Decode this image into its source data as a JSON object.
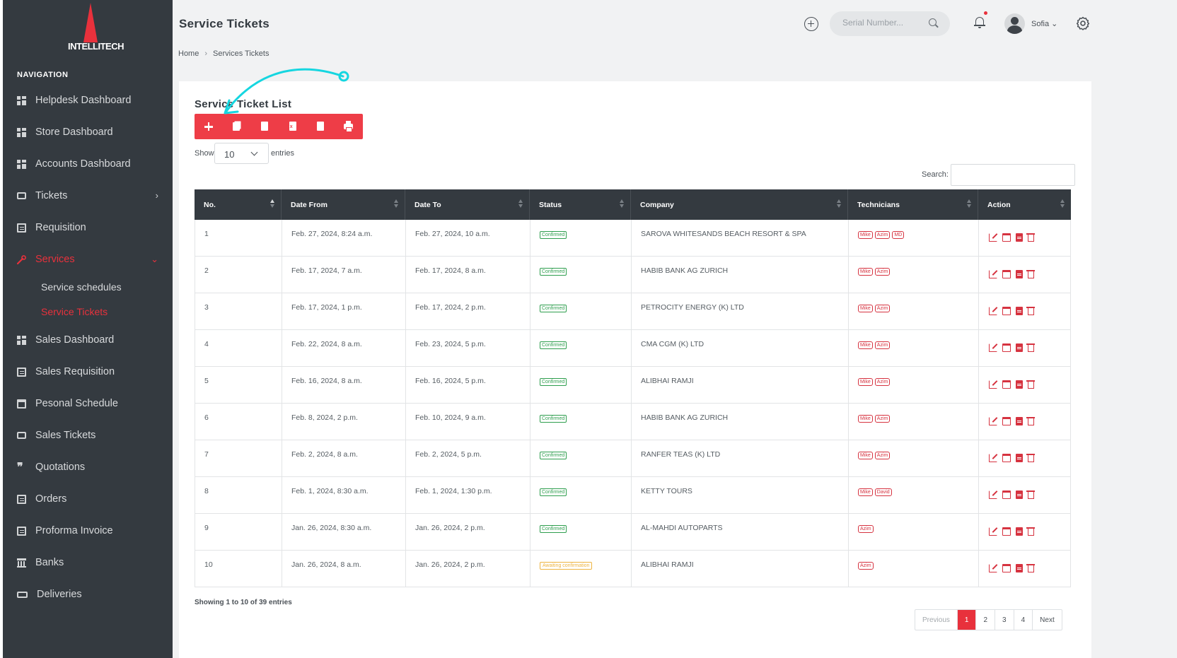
{
  "app": {
    "logo_text": "INTELLITECH"
  },
  "sidebar": {
    "nav_title": "NAVIGATION",
    "items": [
      {
        "label": "Helpdesk Dashboard",
        "icon": "dashboard-icon"
      },
      {
        "label": "Store Dashboard",
        "icon": "dashboard-icon"
      },
      {
        "label": "Accounts Dashboard",
        "icon": "dashboard-icon"
      },
      {
        "label": "Tickets",
        "icon": "ticket-icon",
        "chevron": "›"
      },
      {
        "label": "Requisition",
        "icon": "document-icon"
      },
      {
        "label": "Services",
        "icon": "wrench-icon",
        "chevron": "⌄",
        "active": true
      },
      {
        "label": "Sales Dashboard",
        "icon": "dashboard-icon"
      },
      {
        "label": "Sales Requisition",
        "icon": "document-icon"
      },
      {
        "label": "Pesonal Schedule",
        "icon": "calendar-icon"
      },
      {
        "label": "Sales Tickets",
        "icon": "ticket-icon"
      },
      {
        "label": "Quotations",
        "icon": "quote-icon"
      },
      {
        "label": "Orders",
        "icon": "clipboard-icon"
      },
      {
        "label": "Proforma Invoice",
        "icon": "document-icon"
      },
      {
        "label": "Banks",
        "icon": "bank-icon"
      },
      {
        "label": "Deliveries",
        "icon": "truck-icon"
      }
    ],
    "sub_items": [
      {
        "label": "Service schedules"
      },
      {
        "label": "Service Tickets",
        "active": true
      }
    ]
  },
  "header": {
    "title": "Service Tickets",
    "serial_placeholder": "Serial Number...",
    "user_name": "Sofia ⌄"
  },
  "breadcrumb": {
    "home": "Home",
    "sep": "›",
    "current": "Services Tickets"
  },
  "card": {
    "title": "Service Ticket List",
    "show_label": "Show",
    "page_size": "10",
    "entries_label": "entries",
    "search_label": "Search:",
    "showing_text": "Showing 1 to 10 of 39 entries"
  },
  "table": {
    "columns": [
      "No.",
      "Date From",
      "Date To",
      "Status",
      "Company",
      "Technicians",
      "Action"
    ],
    "rows": [
      {
        "no": "1",
        "from": "Feb. 27, 2024, 8:24 a.m.",
        "to": "Feb. 27, 2024, 10 a.m.",
        "status": "Confirmed",
        "company": "SAROVA WHITESANDS BEACH RESORT & SPA",
        "techs": [
          "Mike",
          "Azim",
          "MD"
        ]
      },
      {
        "no": "2",
        "from": "Feb. 17, 2024, 7 a.m.",
        "to": "Feb. 17, 2024, 8 a.m.",
        "status": "Confirmed",
        "company": "HABIB BANK AG ZURICH",
        "techs": [
          "Mike",
          "Azim"
        ]
      },
      {
        "no": "3",
        "from": "Feb. 17, 2024, 1 p.m.",
        "to": "Feb. 17, 2024, 2 p.m.",
        "status": "Confirmed",
        "company": "PETROCITY ENERGY (K) LTD",
        "techs": [
          "Mike",
          "Azim"
        ]
      },
      {
        "no": "4",
        "from": "Feb. 22, 2024, 8 a.m.",
        "to": "Feb. 23, 2024, 5 p.m.",
        "status": "Confirmed",
        "company": "CMA CGM (K) LTD",
        "techs": [
          "Mike",
          "Azim"
        ]
      },
      {
        "no": "5",
        "from": "Feb. 16, 2024, 8 a.m.",
        "to": "Feb. 16, 2024, 5 p.m.",
        "status": "Confirmed",
        "company": "ALIBHAI RAMJI",
        "techs": [
          "Mike",
          "Azim"
        ]
      },
      {
        "no": "6",
        "from": "Feb. 8, 2024, 2 p.m.",
        "to": "Feb. 10, 2024, 9 a.m.",
        "status": "Confirmed",
        "company": "HABIB BANK AG ZURICH",
        "techs": [
          "Mike",
          "Azim"
        ]
      },
      {
        "no": "7",
        "from": "Feb. 2, 2024, 8 a.m.",
        "to": "Feb. 2, 2024, 5 p.m.",
        "status": "Confirmed",
        "company": "RANFER TEAS (K) LTD",
        "techs": [
          "Mike",
          "Azim"
        ]
      },
      {
        "no": "8",
        "from": "Feb. 1, 2024, 8:30 a.m.",
        "to": "Feb. 1, 2024, 1:30 p.m.",
        "status": "Confirmed",
        "company": "KETTY TOURS",
        "techs": [
          "Mike",
          "David"
        ]
      },
      {
        "no": "9",
        "from": "Jan. 26, 2024, 8:30 a.m.",
        "to": "Jan. 26, 2024, 2 p.m.",
        "status": "Confirmed",
        "company": "AL-MAHDI AUTOPARTS",
        "techs": [
          "Azim"
        ]
      },
      {
        "no": "10",
        "from": "Jan. 26, 2024, 8 a.m.",
        "to": "Jan. 26, 2024, 2 p.m.",
        "status": "Awaiting confirmation",
        "company": "ALIBHAI RAMJI",
        "techs": [
          "Azim"
        ]
      }
    ]
  },
  "pagination": {
    "previous": "Previous",
    "pages": [
      "1",
      "2",
      "3",
      "4"
    ],
    "current": "1",
    "next": "Next"
  },
  "colors": {
    "accent": "#e8313c",
    "sidebar_bg": "#343a40",
    "confirmed": "#2e9e4e",
    "awaiting": "#eeb440",
    "annotation_arrow": "#16d6e0"
  }
}
